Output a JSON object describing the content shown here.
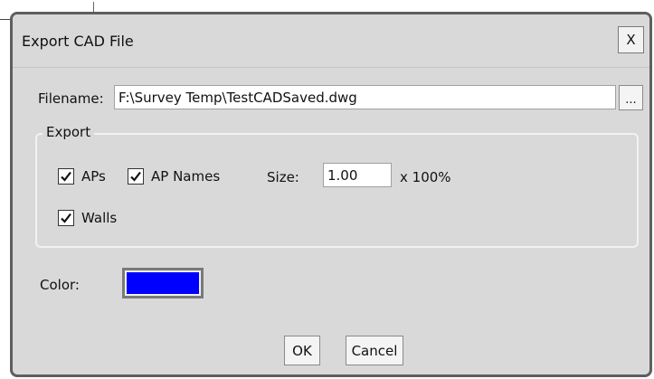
{
  "dialog": {
    "title": "Export CAD File",
    "close_label": "X"
  },
  "filename": {
    "label": "Filename:",
    "value": "F:\\Survey Temp\\TestCADSaved.dwg",
    "browse_label": "..."
  },
  "export_group": {
    "legend": "Export",
    "aps": {
      "label": "APs",
      "checked": true
    },
    "ap_names": {
      "label": "AP Names",
      "checked": true
    },
    "size": {
      "label": "Size:",
      "value": "1.00",
      "unit": "x 100%"
    },
    "walls": {
      "label": "Walls",
      "checked": true
    }
  },
  "color": {
    "label": "Color:",
    "value": "#0000ff"
  },
  "buttons": {
    "ok_label": "OK",
    "cancel_label": "Cancel"
  }
}
